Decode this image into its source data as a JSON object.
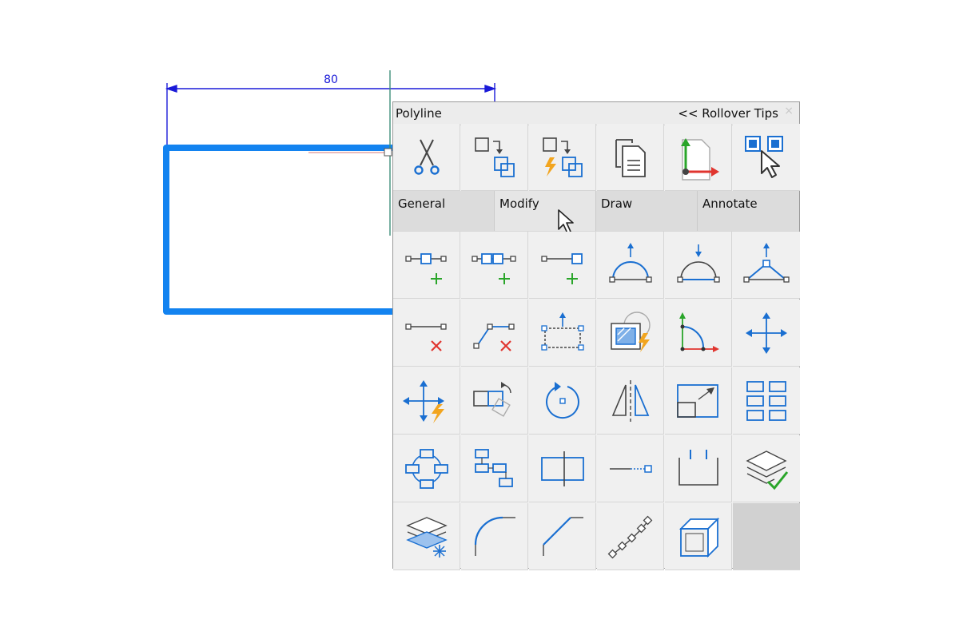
{
  "drawing": {
    "dimension_text": "80"
  },
  "quad": {
    "title": "Polyline",
    "rollover_link": "<< Rollover Tips",
    "close": "×",
    "top_row": [
      {
        "icon": "trim-icon"
      },
      {
        "icon": "copy-icon"
      },
      {
        "icon": "quick-copy-icon"
      },
      {
        "icon": "copy-clipboard-icon"
      },
      {
        "icon": "ucs-icon"
      },
      {
        "icon": "select-similar-icon"
      }
    ],
    "tabs": [
      "General",
      "Modify",
      "Draw",
      "Annotate"
    ],
    "active_hover_tab": "Modify",
    "grid": [
      [
        "add-vertex-icon",
        "insert-vertex-icon",
        "append-vertex-icon",
        "convert-to-arc-icon",
        "convert-to-line-icon",
        "stretch-vertex-icon"
      ],
      [
        "delete-vertex-icon",
        "delete-segment-icon",
        "offset-icon",
        "hatch-quick-icon",
        "fillet-edit-icon",
        "move-icon"
      ],
      [
        "quick-move-icon",
        "rotate-copy-icon",
        "rotate-icon",
        "mirror-icon",
        "scale-icon",
        "array-icon"
      ],
      [
        "circular-array-icon",
        "path-array-icon",
        "align-icon",
        "extend-icon",
        "open-shape-icon",
        "layer-match-icon"
      ],
      [
        "layer-isolate-icon",
        "fillet-icon",
        "chamfer-icon",
        "pattern-polyline-icon",
        "box-3d-icon",
        "empty"
      ]
    ],
    "colors": {
      "blue": "#1a6fd1",
      "green": "#2aa52a",
      "red": "#e0352f",
      "orange": "#f2a51f",
      "gray": "#555555"
    }
  }
}
